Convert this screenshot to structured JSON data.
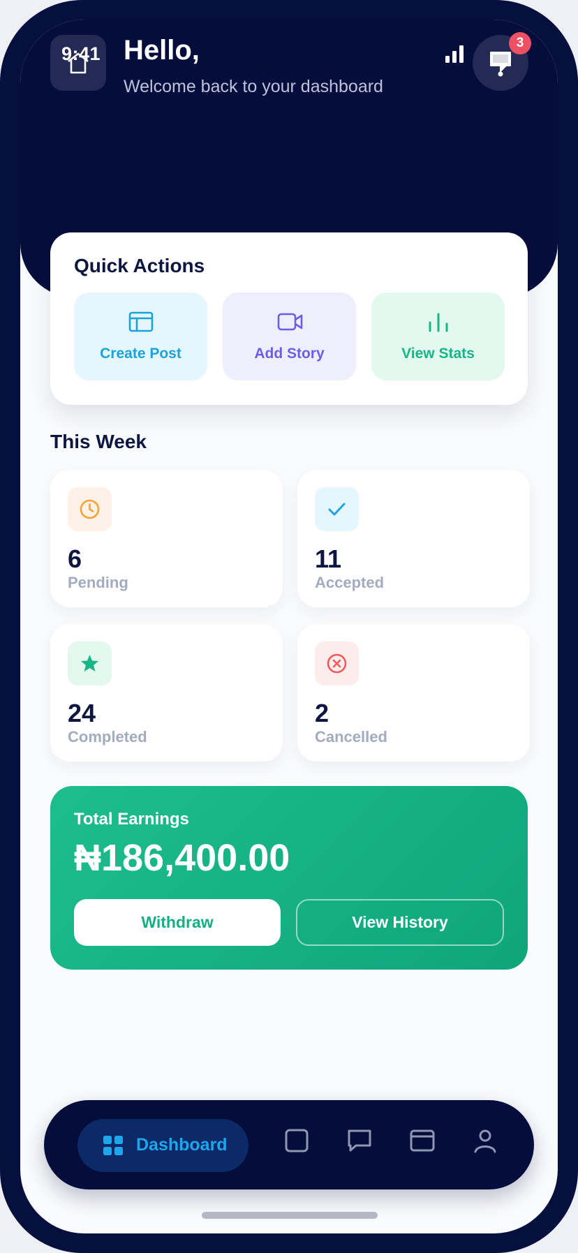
{
  "status_bar": {
    "time": "9:41"
  },
  "header": {
    "greeting": "Hello,",
    "subtitle": "Welcome back to your dashboard",
    "notification_count": "3"
  },
  "quick_actions": {
    "title": "Quick Actions",
    "items": [
      {
        "label": "Create Post",
        "icon": "layout-icon",
        "color": "#1aa3db",
        "bg": "#e6f6fd"
      },
      {
        "label": "Add Story",
        "icon": "video-icon",
        "color": "#6c5ce7",
        "bg": "#efeefc"
      },
      {
        "label": "View Stats",
        "icon": "bar-chart-icon",
        "color": "#18b586",
        "bg": "#e3f8ef"
      }
    ]
  },
  "this_week": {
    "title": "This Week",
    "stats": [
      {
        "value": "6",
        "label": "Pending",
        "icon": "clock-icon",
        "color": "#f5a23a",
        "bg": "#fef1e8"
      },
      {
        "value": "11",
        "label": "Accepted",
        "icon": "check-icon",
        "color": "#1fa4e0",
        "bg": "#e6f6fd"
      },
      {
        "value": "24",
        "label": "Completed",
        "icon": "star-icon",
        "color": "#18b586",
        "bg": "#e3f8ef"
      },
      {
        "value": "2",
        "label": "Cancelled",
        "icon": "x-circle-icon",
        "color": "#ef5a5a",
        "bg": "#fdecec"
      }
    ]
  },
  "earnings": {
    "title": "Total Earnings",
    "amount": "₦186,400.00",
    "withdraw_label": "Withdraw",
    "history_label": "View History"
  },
  "bottom_nav": {
    "active_label": "Dashboard",
    "items": [
      "dashboard-icon",
      "square-icon",
      "chat-icon",
      "window-icon",
      "user-icon"
    ]
  }
}
